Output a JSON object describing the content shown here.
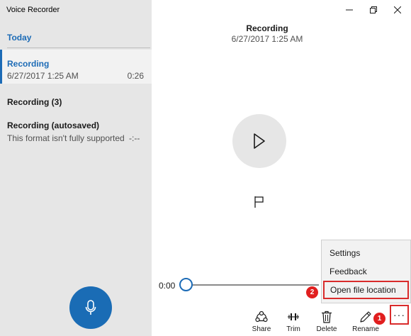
{
  "app": {
    "title": "Voice Recorder"
  },
  "sidebar": {
    "section": "Today",
    "items": [
      {
        "name": "Recording",
        "date": "6/27/2017 1:25 AM",
        "duration": "0:26"
      },
      {
        "name": "Recording (3)"
      },
      {
        "name": "Recording (autosaved)",
        "subtitle": "This format isn't fully supported",
        "duration": "-:--"
      }
    ]
  },
  "main": {
    "title": "Recording",
    "date": "6/27/2017 1:25 AM",
    "time_start": "0:00"
  },
  "toolbar": {
    "share": "Share",
    "trim": "Trim",
    "delete": "Delete",
    "rename": "Rename",
    "more": "···"
  },
  "menu": {
    "items": [
      "Settings",
      "Feedback",
      "Open file location"
    ]
  },
  "badges": [
    "1",
    "2"
  ],
  "colors": {
    "accent": "#1c6bb6",
    "annotation": "#d92b2b"
  }
}
